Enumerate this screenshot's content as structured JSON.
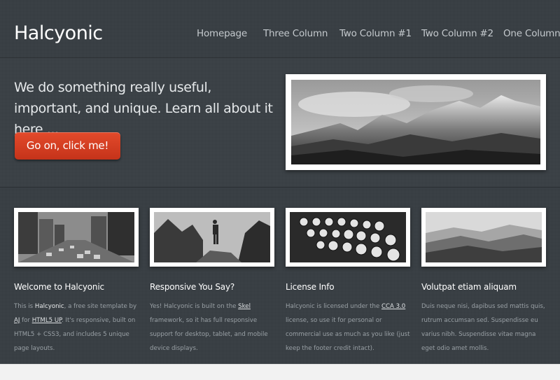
{
  "site": {
    "logo": "Halcyonic"
  },
  "nav": {
    "items": [
      "Homepage",
      "Three Column",
      "Two Column #1",
      "Two Column #2",
      "One Column"
    ]
  },
  "banner": {
    "tagline": "We do something really useful, important, and unique. Learn all about it here ...",
    "cta_label": "Go on, click me!",
    "hero_image_icon": "mountain-range-photo"
  },
  "columns": [
    {
      "title": "Welcome to Halcyonic",
      "image_icon": "city-street-photo",
      "text_parts": {
        "p1": "This is ",
        "brand": "Halcyonic",
        "p2": ", a free site template by ",
        "author_link": "AJ",
        "p3": " for ",
        "framework_link": "HTML5 UP",
        "p4": ". It's responsive, built on HTML5 + CSS3, and includes 5 unique page layouts."
      }
    },
    {
      "title": "Responsive You Say?",
      "image_icon": "hiker-mountains-photo",
      "text_parts": {
        "p1": "Yes! Halcyonic is built on the ",
        "skel_link": "Skel",
        "p2": " framework, so it has full responsive support for desktop, tablet, and mobile device displays."
      }
    },
    {
      "title": "License Info",
      "image_icon": "typewriter-keys-photo",
      "text_parts": {
        "p1": "Halcyonic is licensed under the ",
        "license_link": "CCA 3.0",
        "p2": " license, so use it for personal or commercial use as much as you like (just keep the footer credit intact)."
      }
    },
    {
      "title": "Volutpat etiam aliquam",
      "image_icon": "valley-hills-photo",
      "text_parts": {
        "p1": "Duis neque nisi, dapibus sed mattis quis, rutrum accumsan sed. Suspendisse eu varius nibh. Suspendisse vitae magna eget odio amet mollis."
      }
    }
  ],
  "colors": {
    "background": "#363c41",
    "cta": "#d63f22",
    "heading": "#ffffff",
    "body_text": "#9aa1a6"
  }
}
